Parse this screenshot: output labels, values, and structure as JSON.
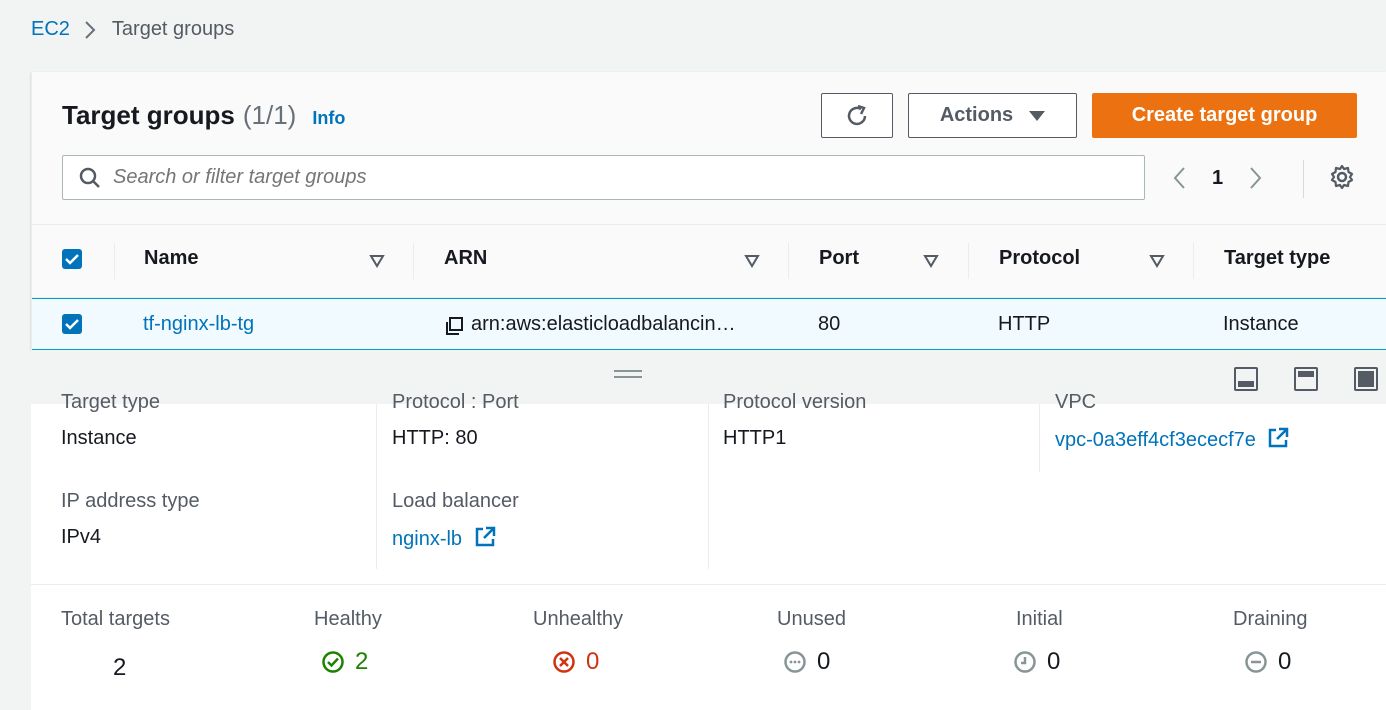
{
  "breadcrumb": {
    "root": "EC2",
    "current": "Target groups"
  },
  "header": {
    "title": "Target groups",
    "count": "(1/1)",
    "info": "Info",
    "actions_label": "Actions",
    "create_label": "Create target group"
  },
  "search": {
    "placeholder": "Search or filter target groups"
  },
  "pagination": {
    "page": "1"
  },
  "table": {
    "columns": [
      "Name",
      "ARN",
      "Port",
      "Protocol",
      "Target type"
    ],
    "rows": [
      {
        "name": "tf-nginx-lb-tg",
        "arn": "arn:aws:elasticloadbalancin…",
        "port": "80",
        "protocol": "HTTP",
        "target_type": "Instance"
      }
    ]
  },
  "details": {
    "target_type_label": "Target type",
    "target_type_value": "Instance",
    "protocol_port_label": "Protocol : Port",
    "protocol_port_value": "HTTP: 80",
    "protocol_version_label": "Protocol version",
    "protocol_version_value": "HTTP1",
    "vpc_label": "VPC",
    "vpc_value": "vpc-0a3eff4cf3ececf7e",
    "ip_type_label": "IP address type",
    "ip_type_value": "IPv4",
    "lb_label": "Load balancer",
    "lb_value": "nginx-lb"
  },
  "stats": {
    "total_label": "Total targets",
    "total_value": "2",
    "healthy_label": "Healthy",
    "healthy_value": "2",
    "unhealthy_label": "Unhealthy",
    "unhealthy_value": "0",
    "unused_label": "Unused",
    "unused_value": "0",
    "initial_label": "Initial",
    "initial_value": "0",
    "draining_label": "Draining",
    "draining_value": "0"
  },
  "colors": {
    "link": "#0073bb",
    "primary": "#ec7211",
    "healthy": "#1d8102",
    "unhealthy": "#d13212",
    "neutral": "#879596"
  }
}
